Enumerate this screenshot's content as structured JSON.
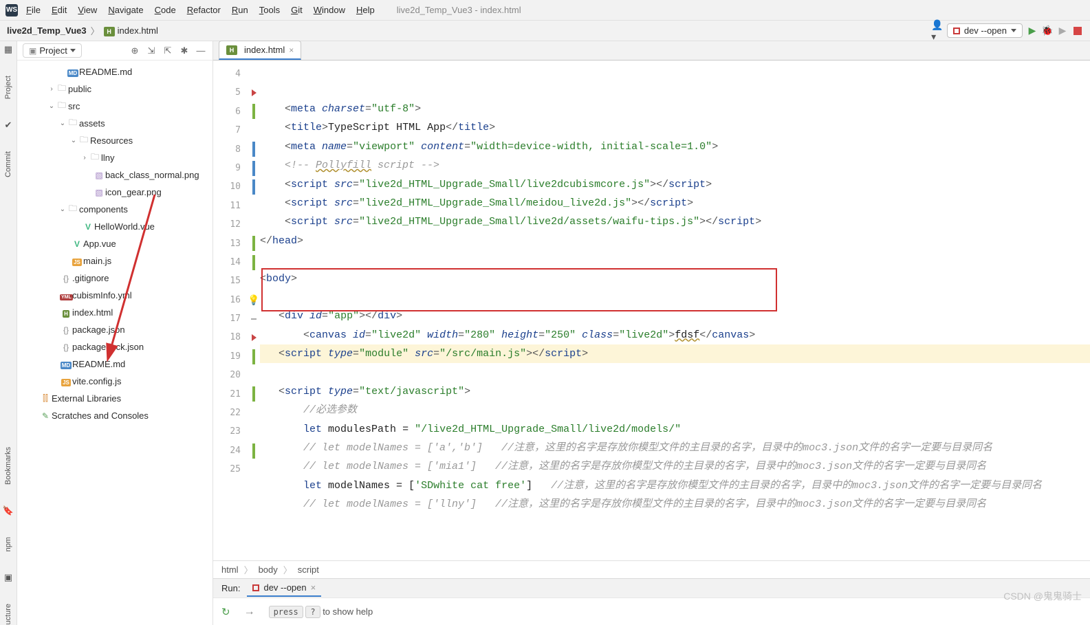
{
  "menus": [
    "File",
    "Edit",
    "View",
    "Navigate",
    "Code",
    "Refactor",
    "Run",
    "Tools",
    "Git",
    "Window",
    "Help"
  ],
  "window_title": "live2d_Temp_Vue3 - index.html",
  "nav": {
    "project": "live2d_Temp_Vue3",
    "file": "index.html"
  },
  "run_config": {
    "label": "dev --open"
  },
  "project_panel": {
    "title": "Project"
  },
  "tree": [
    {
      "indent": 60,
      "icon": "md",
      "label": "README.md",
      "arrow": ""
    },
    {
      "indent": 44,
      "icon": "folder",
      "label": "public",
      "arrow": ">"
    },
    {
      "indent": 44,
      "icon": "folder",
      "label": "src",
      "arrow": "v"
    },
    {
      "indent": 60,
      "icon": "folder",
      "label": "assets",
      "arrow": "v"
    },
    {
      "indent": 76,
      "icon": "folder",
      "label": "Resources",
      "arrow": "v"
    },
    {
      "indent": 92,
      "icon": "folder",
      "label": "llny",
      "arrow": ">"
    },
    {
      "indent": 98,
      "icon": "img",
      "label": "back_class_normal.png",
      "arrow": ""
    },
    {
      "indent": 98,
      "icon": "img",
      "label": "icon_gear.png",
      "arrow": ""
    },
    {
      "indent": 60,
      "icon": "folder",
      "label": "components",
      "arrow": "v"
    },
    {
      "indent": 82,
      "icon": "vue",
      "label": "HelloWorld.vue",
      "arrow": ""
    },
    {
      "indent": 66,
      "icon": "vue",
      "label": "App.vue",
      "arrow": ""
    },
    {
      "indent": 66,
      "icon": "js",
      "label": "main.js",
      "arrow": ""
    },
    {
      "indent": 50,
      "icon": "json",
      "label": ".gitignore",
      "arrow": ""
    },
    {
      "indent": 50,
      "icon": "yml",
      "label": "cubismInfo.yml",
      "arrow": ""
    },
    {
      "indent": 50,
      "icon": "html",
      "label": "index.html",
      "arrow": ""
    },
    {
      "indent": 50,
      "icon": "json",
      "label": "package.json",
      "arrow": ""
    },
    {
      "indent": 50,
      "icon": "json",
      "label": "package-lock.json",
      "arrow": ""
    },
    {
      "indent": 50,
      "icon": "md",
      "label": "README.md",
      "arrow": ""
    },
    {
      "indent": 50,
      "icon": "js",
      "label": "vite.config.js",
      "arrow": ""
    },
    {
      "indent": 20,
      "icon": "ext",
      "label": "External Libraries",
      "arrow": ""
    },
    {
      "indent": 20,
      "icon": "scratch",
      "label": "Scratches and Consoles",
      "arrow": ""
    }
  ],
  "editor_tab": "index.html",
  "line_numbers": [
    4,
    5,
    6,
    7,
    8,
    9,
    10,
    11,
    12,
    13,
    14,
    15,
    16,
    17,
    18,
    19,
    20,
    21,
    22,
    23,
    24,
    25
  ],
  "gutters": [
    "",
    "red-tri",
    "green",
    "",
    "blue",
    "blue",
    "blue",
    "",
    "",
    "green",
    "green",
    "",
    "bulb",
    "dash",
    "red-tri",
    "green",
    "",
    "green",
    "",
    "",
    "green",
    ""
  ],
  "code": {
    "l4": {
      "pre": "    <",
      "tag": "meta ",
      "attr": "charset",
      "mid": "=",
      "str": "\"utf-8\"",
      "post": ">"
    },
    "l5": {
      "pre": "    <",
      "tag": "title",
      "post1": ">",
      "txt": "TypeScript HTML App",
      "pre2": "</",
      "tag2": "title",
      "post2": ">"
    },
    "l6": {
      "pre": "    <",
      "tag": "meta ",
      "attr": "name",
      "mid": "=",
      "str": "\"viewport\" ",
      "attr2": "content",
      "mid2": "=",
      "str2": "\"width=device-width, initial-scale=1.0\"",
      "post": ">"
    },
    "l7": {
      "cmt": "    <!-- Pollyfill script -->",
      "underline": "Pollyfill"
    },
    "l8": {
      "pre": "    <",
      "tag": "script ",
      "attr": "src",
      "mid": "=",
      "str": "\"live2d_HTML_Upgrade_Small/live2dcubismcore.js\"",
      "post": "></",
      "tag2": "script",
      "post2": ">"
    },
    "l9": {
      "pre": "    <",
      "tag": "script ",
      "attr": "src",
      "mid": "=",
      "str": "\"live2d_HTML_Upgrade_Small/meidou_live2d.js\"",
      "post": "></",
      "tag2": "script",
      "post2": ">"
    },
    "l10": {
      "pre": "    <",
      "tag": "script ",
      "attr": "src",
      "mid": "=",
      "str": "\"live2d_HTML_Upgrade_Small/live2d/assets/waifu-tips.js\"",
      "post": "></",
      "tag2": "script",
      "post2": ">"
    },
    "l11": {
      "pre": "</",
      "tag": "head",
      "post": ">"
    },
    "l12": {
      "txt": ""
    },
    "l13": {
      "pre": "<",
      "tag": "body",
      "post": ">"
    },
    "l14": {
      "txt": ""
    },
    "l15": {
      "pre": "   <",
      "tag": "div ",
      "attr": "id",
      "mid": "=",
      "str": "\"app\"",
      "post": "></",
      "tag2": "div",
      "post2": ">"
    },
    "l16": {
      "pre": "       <",
      "tag": "canvas ",
      "attr": "id",
      "mid": "=",
      "str": "\"live2d\" ",
      "attr2": "width",
      "mid2": "=",
      "str2": "\"280\" ",
      "attr3": "height",
      "mid3": "=",
      "str3": "\"250\" ",
      "attr4": "class",
      "mid4": "=",
      "str4": "\"live2d\"",
      "post": ">",
      "txt": "fdsf",
      "pre2": "</",
      "tag2": "canvas",
      "post2": ">"
    },
    "l17": {
      "pre": "   <",
      "tag": "script ",
      "attr": "type",
      "mid": "=",
      "str": "\"module\" ",
      "attr2": "src",
      "mid2": "=",
      "str2": "\"/src/main.js\"",
      "post": "></",
      "tag2": "script",
      "post2": ">"
    },
    "l18": {
      "txt": ""
    },
    "l19": {
      "pre": "   <",
      "tag": "script ",
      "attr": "type",
      "mid": "=",
      "str": "\"text/javascript\"",
      "post": ">"
    },
    "l20": {
      "cmt": "       //必选参数"
    },
    "l21": {
      "pre": "       ",
      "kw": "let ",
      "var": "modulesPath",
      "mid": " = ",
      "str": "\"/live2d_HTML_Upgrade_Small/live2d/models/\""
    },
    "l22": {
      "cmt": "       // let modelNames = ['a','b']   //注意，这里的名字是存放你模型文件的主目录的名字，目录中的moc3.json文件的名字一定要与目录同名"
    },
    "l23": {
      "cmt": "       // let modelNames = ['mia1']   //注意，这里的名字是存放你模型文件的主目录的名字，目录中的moc3.json文件的名字一定要与目录同名"
    },
    "l24": {
      "pre": "       ",
      "kw": "let ",
      "var": "modelNames",
      "mid": " = [",
      "str": "'SDwhite cat free'",
      "mid2": "]   ",
      "cmt": "//注意，这里的名字是存放你模型文件的主目录的名字，目录中的moc3.json文件的名字一定要与目录同名"
    },
    "l25": {
      "cmt": "       // let modelNames = ['llny']   //注意，这里的名字是存放你模型文件的主目录的名字，目录中的moc3.json文件的名字一定要与目录同名"
    }
  },
  "breadcrumbs": [
    "html",
    "body",
    "script"
  ],
  "run_tool": {
    "label": "Run:",
    "tab": "dev --open",
    "hint_press": "press",
    "hint_cmd": "?",
    "hint_rest": "to show help"
  },
  "stripes": {
    "project": "Project",
    "commit": "Commit",
    "bookmarks": "Bookmarks",
    "npm": "npm",
    "structure": "ucture"
  },
  "watermark": "CSDN @鬼鬼骑士"
}
